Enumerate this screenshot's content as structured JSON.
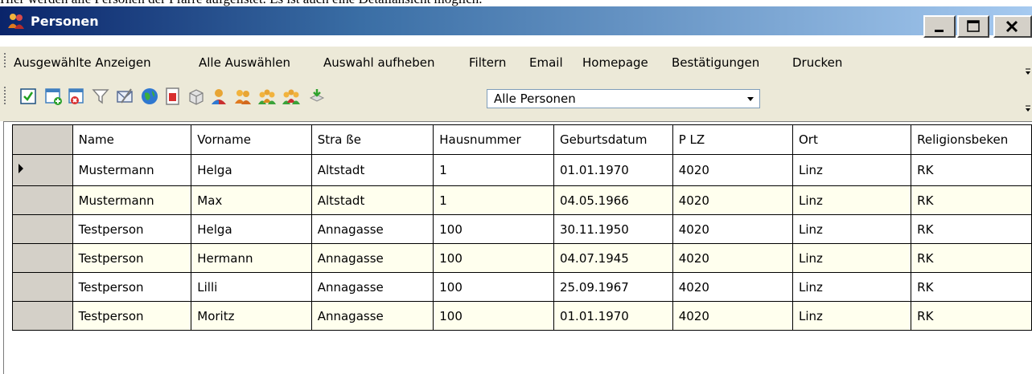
{
  "caption": "Hier werden alle Personen der Pfarre aufgelistet. Es ist auch eine Detailansicht möglich.",
  "window": {
    "title": "Personen",
    "controls": {
      "minimize": "_",
      "maximize": "□",
      "close": "×"
    }
  },
  "menu": {
    "items": [
      "Ausgewählte Anzeigen",
      "Alle Auswählen",
      "Auswahl aufheben",
      "Filtern",
      "Email",
      "Homepage",
      "Bestätigungen",
      "Drucken"
    ]
  },
  "toolbar": {
    "icons": [
      "checkbox-icon",
      "add-row-icon",
      "delete-row-icon",
      "filter-icon",
      "email-icon",
      "globe-icon",
      "report-icon",
      "box-icon",
      "person-icon",
      "persons-icon",
      "group-icon",
      "group-alt-icon",
      "export-icon"
    ],
    "filter_select": {
      "value": "Alle Personen"
    }
  },
  "grid": {
    "columns": [
      "Name",
      "Vorname",
      "Stra ße",
      "Hausnummer",
      "Geburtsdatum",
      "P LZ",
      "Ort",
      "Religionsbeken"
    ],
    "rows": [
      [
        "Mustermann",
        "Helga",
        "Altstadt",
        "1",
        "01.01.1970",
        "4020",
        "Linz",
        "RK"
      ],
      [
        "Mustermann",
        "Max",
        "Altstadt",
        "1",
        "04.05.1966",
        "4020",
        "Linz",
        "RK"
      ],
      [
        "Testperson",
        "Helga",
        "Annagasse",
        "100",
        "30.11.1950",
        "4020",
        "Linz",
        "RK"
      ],
      [
        "Testperson",
        "Hermann",
        "Annagasse",
        "100",
        "04.07.1945",
        "4020",
        "Linz",
        "RK"
      ],
      [
        "Testperson",
        "Lilli",
        "Annagasse",
        "100",
        "25.09.1967",
        "4020",
        "Linz",
        "RK"
      ],
      [
        "Testperson",
        "Moritz",
        "Annagasse",
        "100",
        "01.01.1970",
        "4020",
        "Linz",
        "RK"
      ]
    ],
    "current_row": 0,
    "alt_row_color": "#ffffee"
  }
}
